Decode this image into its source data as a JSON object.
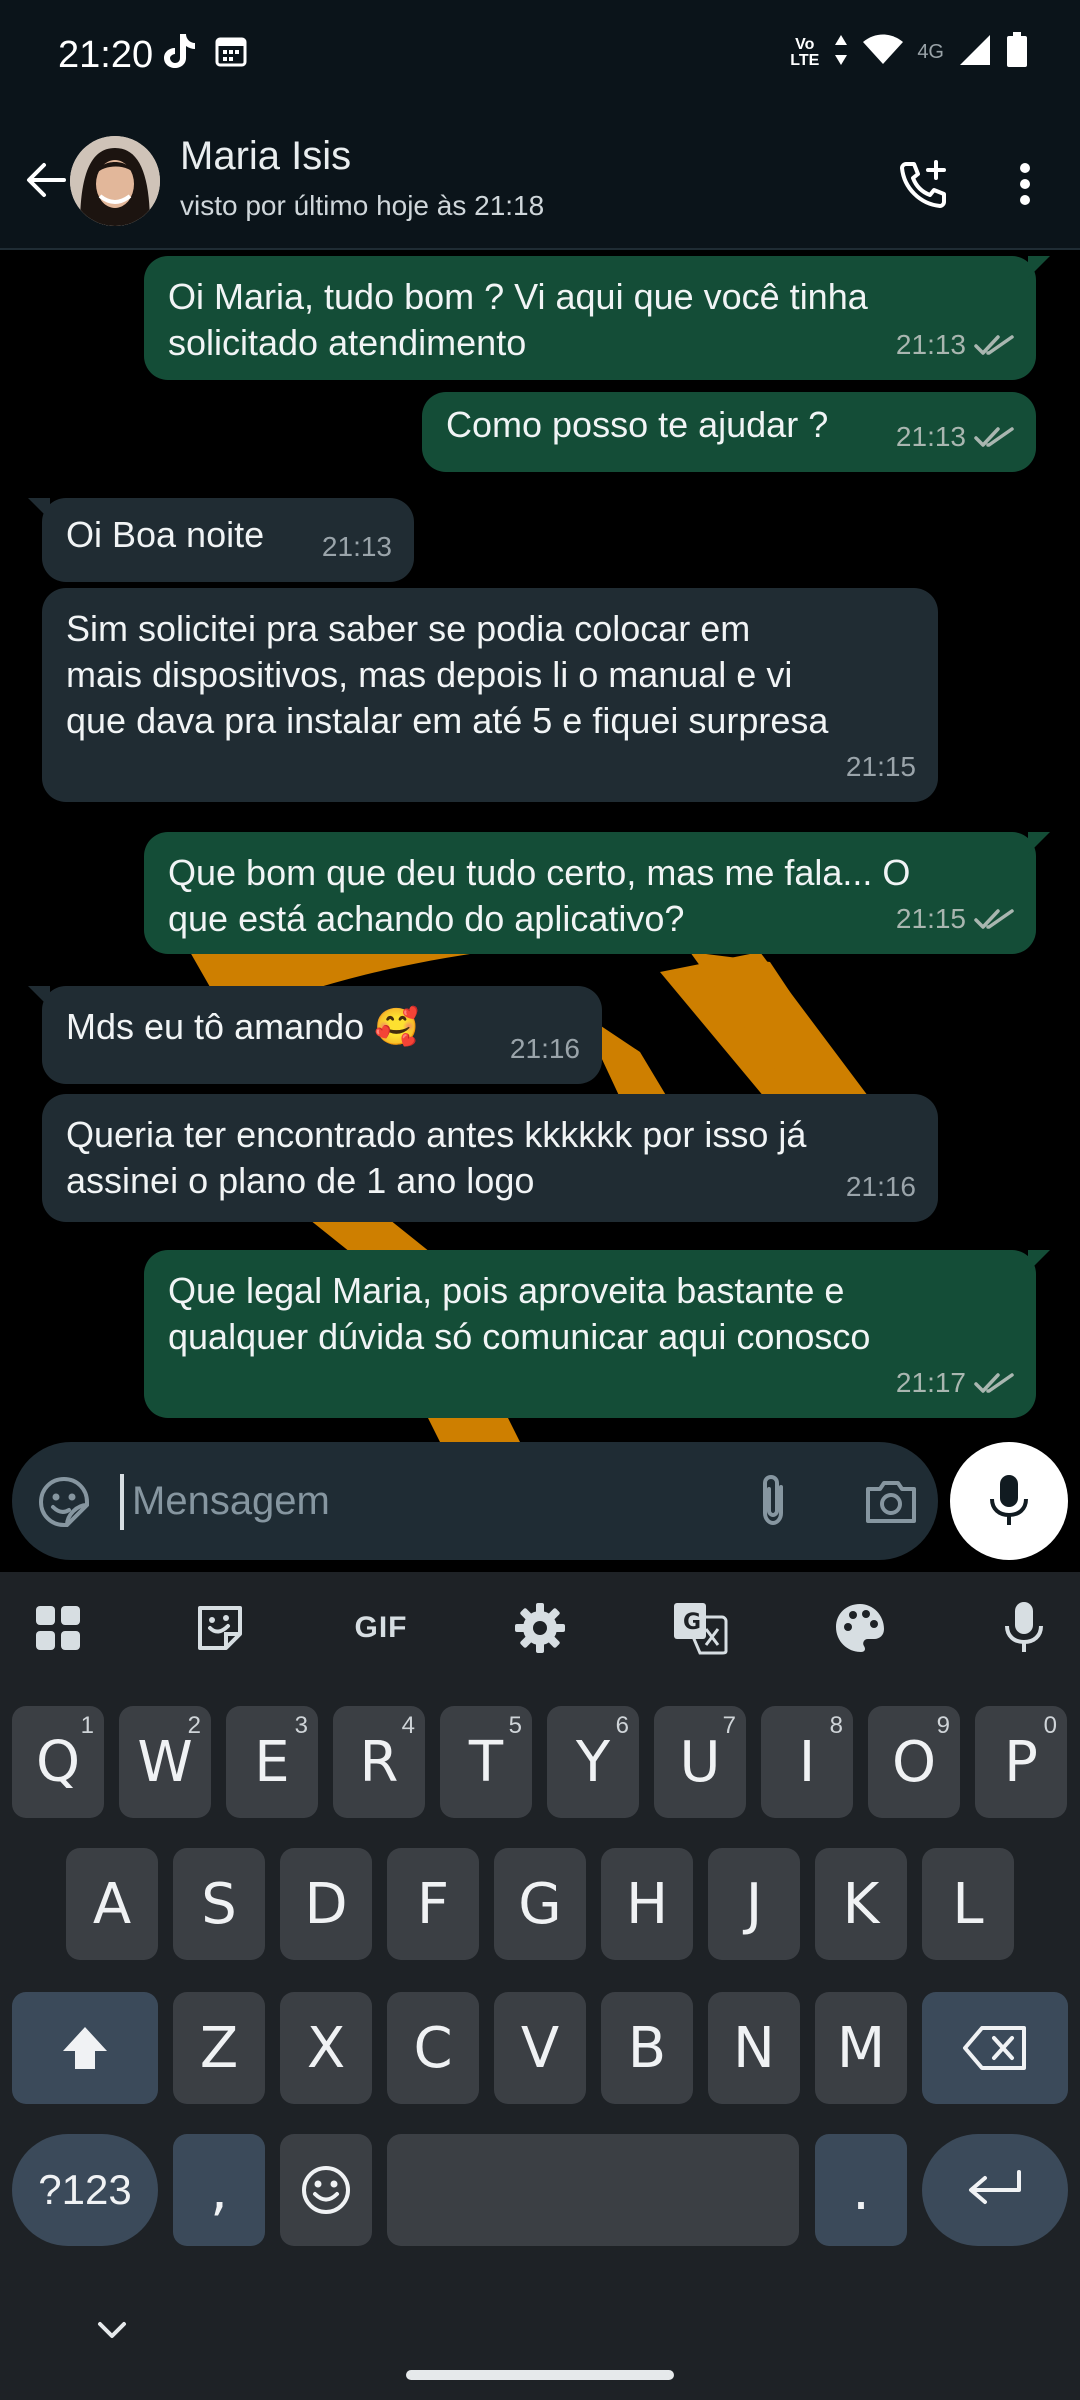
{
  "status_bar": {
    "time": "21:20",
    "left_icons": [
      "tiktok-icon",
      "calendar-icon"
    ],
    "volte_line1": "Vo",
    "volte_line2": "LTE",
    "network": "4G",
    "right_icons": [
      "data-arrows-icon",
      "wifi-icon",
      "signal-icon",
      "battery-icon"
    ]
  },
  "header": {
    "contact_name": "Maria Isis",
    "last_seen": "visto por último hoje às 21:18",
    "icons": [
      "back-arrow-icon",
      "add-call-icon",
      "more-vert-icon"
    ]
  },
  "messages": [
    {
      "direction": "out",
      "text": "Oi Maria, tudo bom ? Vi aqui que você tinha\nsolicitado atendimento",
      "time": "21:13",
      "status": "read"
    },
    {
      "direction": "out",
      "text": "Como posso te ajudar ?",
      "time": "21:13",
      "status": "read"
    },
    {
      "direction": "in",
      "text": "Oi Boa noite",
      "time": "21:13"
    },
    {
      "direction": "in",
      "text": "Sim solicitei pra saber se podia colocar em\nmais dispositivos, mas depois li o manual e vi\nque dava pra instalar em até 5 e fiquei surpresa",
      "time": "21:15"
    },
    {
      "direction": "out",
      "text": "Que bom que deu tudo certo, mas me fala... O\nque está achando do aplicativo?",
      "time": "21:15",
      "status": "read"
    },
    {
      "direction": "in",
      "text": "Mds eu tô amando 🥰",
      "time": "21:16"
    },
    {
      "direction": "in",
      "text": "Queria ter encontrado antes kkkkkk por isso já\nassinei o plano de 1 ano logo",
      "time": "21:16"
    },
    {
      "direction": "out",
      "text": "Que legal Maria, pois aproveita bastante e\nqualquer dúvida só comunicar aqui conosco",
      "time": "21:17",
      "status": "read"
    }
  ],
  "composer": {
    "placeholder": "Mensagem",
    "icons": [
      "emoji-icon",
      "attach-icon",
      "camera-icon",
      "mic-icon"
    ]
  },
  "keyboard": {
    "toolbar": [
      "apps-grid-icon",
      "sticker-icon",
      "gif-icon",
      "settings-icon",
      "translate-icon",
      "palette-icon",
      "voice-icon"
    ],
    "gif_label": "GIF",
    "row1": [
      {
        "key": "Q",
        "hint": "1"
      },
      {
        "key": "W",
        "hint": "2"
      },
      {
        "key": "E",
        "hint": "3"
      },
      {
        "key": "R",
        "hint": "4"
      },
      {
        "key": "T",
        "hint": "5"
      },
      {
        "key": "Y",
        "hint": "6"
      },
      {
        "key": "U",
        "hint": "7"
      },
      {
        "key": "I",
        "hint": "8"
      },
      {
        "key": "O",
        "hint": "9"
      },
      {
        "key": "P",
        "hint": "0"
      }
    ],
    "row2": [
      "A",
      "S",
      "D",
      "F",
      "G",
      "H",
      "J",
      "K",
      "L"
    ],
    "row3": [
      "Z",
      "X",
      "C",
      "V",
      "B",
      "N",
      "M"
    ],
    "symbols_label": "?123",
    "comma_label": ",",
    "period_label": ".",
    "special_icons": [
      "shift-icon",
      "backspace-icon",
      "emoji-key-icon",
      "enter-icon",
      "chevron-down-icon"
    ]
  },
  "colors": {
    "outgoing_bubble": "#144d37",
    "incoming_bubble": "#202c33",
    "read_ticks": "#a9b6b0",
    "wallpaper_accent": "#e08a00"
  }
}
